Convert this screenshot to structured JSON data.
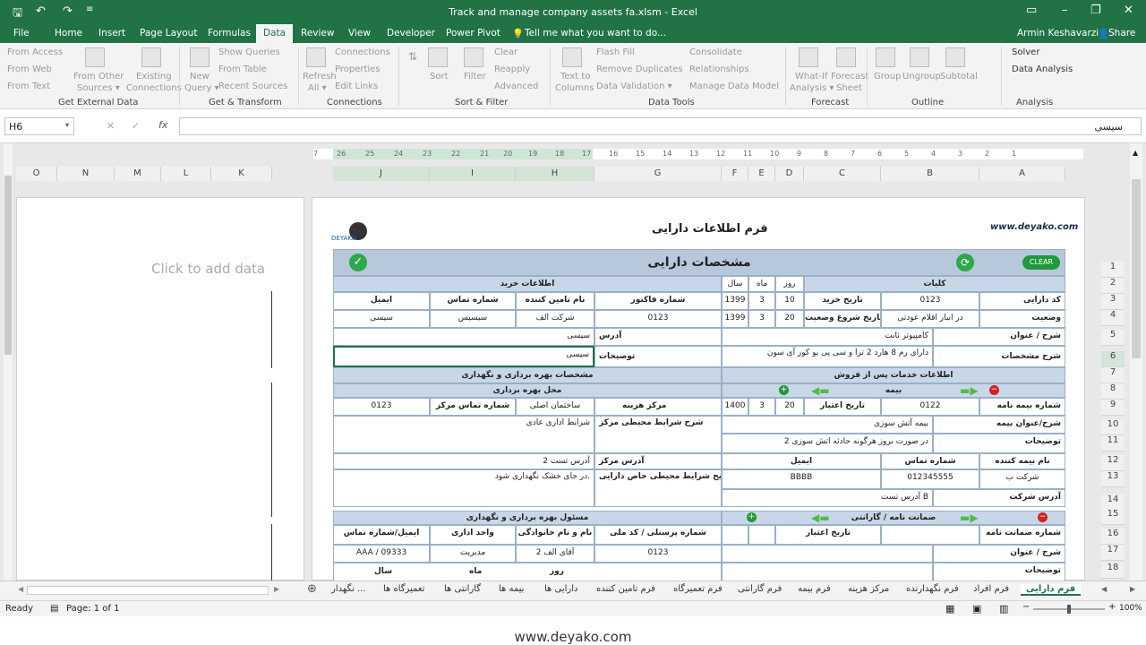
{
  "window": {
    "title": "Track and manage company assets fa.xlsm - Excel"
  },
  "ribbon_tabs": [
    "File",
    "Home",
    "Insert",
    "Page Layout",
    "Formulas",
    "Data",
    "Review",
    "View",
    "Developer",
    "Power Pivot"
  ],
  "tell_me": "Tell me what you want to do...",
  "user": "Armin Keshavarzi",
  "share": "Share",
  "ribbon": {
    "from_access": "From Access",
    "from_web": "From Web",
    "from_text": "From Text",
    "from_other": "From Other",
    "sources": "Sources ▾",
    "existing": "Existing",
    "connections_btn": "Connections",
    "new": "New",
    "query": "Query ▾",
    "show_queries": "Show Queries",
    "from_table": "From Table",
    "recent_sources": "Recent Sources",
    "refresh": "Refresh",
    "all": "All ▾",
    "conn": "Connections",
    "properties": "Properties",
    "edit_links": "Edit Links",
    "sort": "Sort",
    "filter": "Filter",
    "clear": "Clear",
    "reapply": "Reapply",
    "advanced": "Advanced",
    "text_to": "Text to",
    "columns": "Columns",
    "flash_fill": "Flash Fill",
    "remove_dup": "Remove Duplicates",
    "data_validation": "Data Validation ▾",
    "consolidate": "Consolidate",
    "relationships": "Relationships",
    "manage_model": "Manage Data Model",
    "whatif": "What-If",
    "analysis": "Analysis ▾",
    "forecast": "Forecast",
    "sheet": "Sheet",
    "group": "Group",
    "ungroup": "Ungroup",
    "subtotal": "Subtotal",
    "solver": "Solver",
    "data_analysis": "Data Analysis",
    "groups": [
      "Get External Data",
      "Get & Transform",
      "Connections",
      "Sort & Filter",
      "Data Tools",
      "Forecast",
      "Outline",
      "Analysis"
    ]
  },
  "formula_bar": {
    "name_box": "H6",
    "value": "سیسی"
  },
  "columns_left": [
    "O",
    "N",
    "M",
    "L",
    "K"
  ],
  "columns_right": [
    "J",
    "I",
    "H",
    "G",
    "F",
    "E",
    "D",
    "C",
    "B",
    "A"
  ],
  "rows": [
    "1",
    "2",
    "3",
    "4",
    "5",
    "6",
    "7",
    "8",
    "9",
    "10",
    "11",
    "12",
    "13",
    "14",
    "15",
    "16",
    "17",
    "18"
  ],
  "click_to_add": "Click to add data",
  "ruler_ticks": [
    "7",
    "26",
    "25",
    "24",
    "23",
    "22",
    "21",
    "20",
    "19",
    "18",
    "17",
    "16",
    "15",
    "14",
    "13",
    "12",
    "11",
    "10",
    "9",
    "8",
    "7",
    "6",
    "5",
    "4",
    "3",
    "2",
    "1"
  ],
  "form": {
    "site": "www.deyako.com",
    "logo": "DEYAKO",
    "title": "فرم اطلاعات دارایی",
    "header": "مشخصات دارایی",
    "clear": "CLEAR",
    "general": "کلیات",
    "purchase_info": "اطلاعات خرید",
    "year": "سال",
    "month": "ماه",
    "day": "روز",
    "asset_code": "کد دارایی",
    "asset_code_v": "0123",
    "buy_date": "تاریخ خرید",
    "buy_y": "1399",
    "buy_m": "3",
    "buy_d": "10",
    "status": "وضعیت",
    "status_v": "در انبار اقلام عودتی",
    "start_date": "تاریخ شروع وضعیت",
    "st_y": "1399",
    "st_m": "3",
    "st_d": "20",
    "title_lbl": "شرح / عنوان",
    "title_v": "کامپیوتر ثابت",
    "spec_lbl": "شرح مشخصات",
    "spec_v": "دارای رم 8 هارد 2 ترا و سی پی یو کور آی سون",
    "invoice": "شماره فاکتور",
    "supplier": "نام تامین کننده",
    "contact": "شماره تماس",
    "email": "ایمیل",
    "invoice_v": "0123",
    "supplier_v": "شرکت الف",
    "contact_v": "سیسیس",
    "email_v": "سیسی",
    "address": "آدرس",
    "address_v": "سیسی",
    "desc": "توضیحات",
    "desc_v": "سیسی",
    "after_sales": "اطلاعات خدمات پس از فروش",
    "maint_spec": "مشخصات بهره برداری و نگهداری",
    "insurance": "بیمه",
    "location": "محل بهره برداری",
    "ins_no": "شماره بیمه نامه",
    "ins_no_v": "0122",
    "validity": "تاریخ اعتبار",
    "v_y": "1400",
    "v_m": "3",
    "v_d": "20",
    "ins_title": "شرح/عنوان بیمه",
    "ins_title_v": "بیمه آتش سوزی",
    "ins_desc": "توضیحات",
    "ins_desc_v": "در صورت بروز هرگونه حادثه اتش سوزی 2",
    "insurer": "نام بیمه کننده",
    "ins_contact": "شماره تماس",
    "ins_email": "ایمیل",
    "insurer_v": "شرکت ب",
    "ins_contact_v": "012345555",
    "ins_email_v": "BBBB",
    "ins_address": "آدرس شرکت",
    "ins_address_v": "آدرس تست B",
    "cost_center": "مرکز هزینه",
    "cost_center_v": "ساختمان اصلی",
    "center_contact": "شماره تماس مرکز",
    "center_contact_v": "0123",
    "env": "شرح شرایط محیطی مرکز",
    "env_v": "شرایط اداری عادی",
    "center_addr": "آدرس مرکز",
    "center_addr_v": "آدرس تست 2",
    "special_env": "توضیح شرایط محیطی خاص دارایی",
    "special_env_v": "در جای خشک نگهداری شود.",
    "guarantee": "ضمانت نامه / گارانتی",
    "guarantee_no": "شماره ضمانت نامه",
    "g_validity": "تاریخ اعتبار",
    "g_title": "شرح / عنوان",
    "g_desc": "توضیحات",
    "responsible": "مسئول بهره برداری و نگهداری",
    "personnel": "شماره پرسنلی / کد ملی",
    "fullname": "نام و نام خانوادگی",
    "unit": "واحد اداری",
    "email_contact": "ایمیل/شماره تماس",
    "personnel_v": "0123",
    "fullname_v": "آقای الف 2",
    "unit_v": "مدیریت",
    "email_contact_v": "AAA / 09333",
    "r_day": "روز",
    "r_month": "ماه",
    "r_year": "سال"
  },
  "sheet_tabs": [
    "فرم دارایی",
    "فرم افراد",
    "فرم نگهدارنده",
    "مرکز هزینه",
    "فرم بیمه",
    "فرم گارانتی",
    "فرم تعمیرگاه",
    "فرم تامین کننده",
    "دارایی ها",
    "بیمه ها",
    "گارانتی ها",
    "تعمیرگاه ها",
    "نگهدار ..."
  ],
  "status": {
    "ready": "Ready",
    "page": "Page: 1 of 1",
    "zoom": "100%"
  },
  "footer": "www.deyako.com"
}
